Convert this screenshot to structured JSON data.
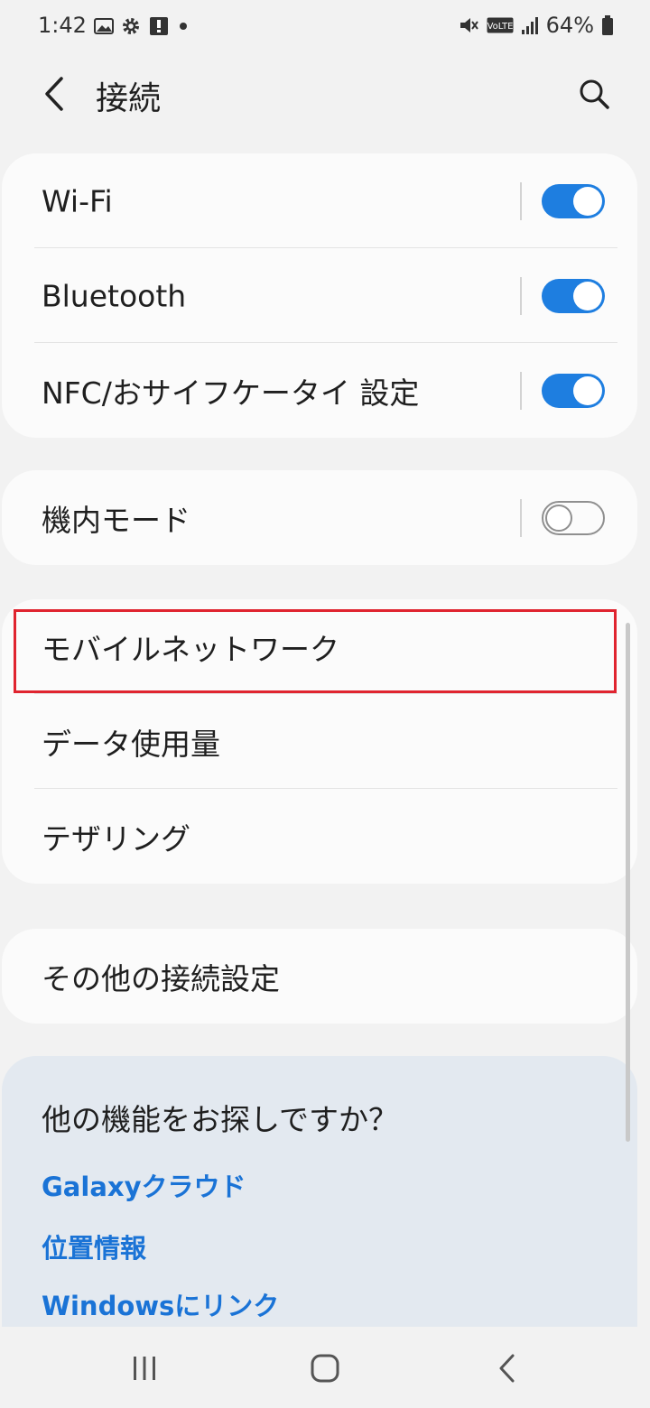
{
  "status": {
    "time": "1:42",
    "battery": "64%",
    "volte": "VoLTE"
  },
  "header": {
    "title": "接続"
  },
  "group1": [
    {
      "label": "Wi-Fi",
      "on": true
    },
    {
      "label": "Bluetooth",
      "on": true
    },
    {
      "label": "NFC/おサイフケータイ 設定",
      "on": true
    }
  ],
  "group2": [
    {
      "label": "機内モード",
      "on": false
    }
  ],
  "group3": [
    {
      "label": "モバイルネットワーク"
    },
    {
      "label": "データ使用量"
    },
    {
      "label": "テザリング"
    }
  ],
  "group4": [
    {
      "label": "その他の接続設定"
    }
  ],
  "help": {
    "title": "他の機能をお探しですか？",
    "links": [
      "Galaxyクラウド",
      "位置情報",
      "Windowsにリンク"
    ]
  },
  "colors": {
    "accent": "#1e7ee0",
    "link": "#1a73d6",
    "highlight": "#e0242f"
  }
}
